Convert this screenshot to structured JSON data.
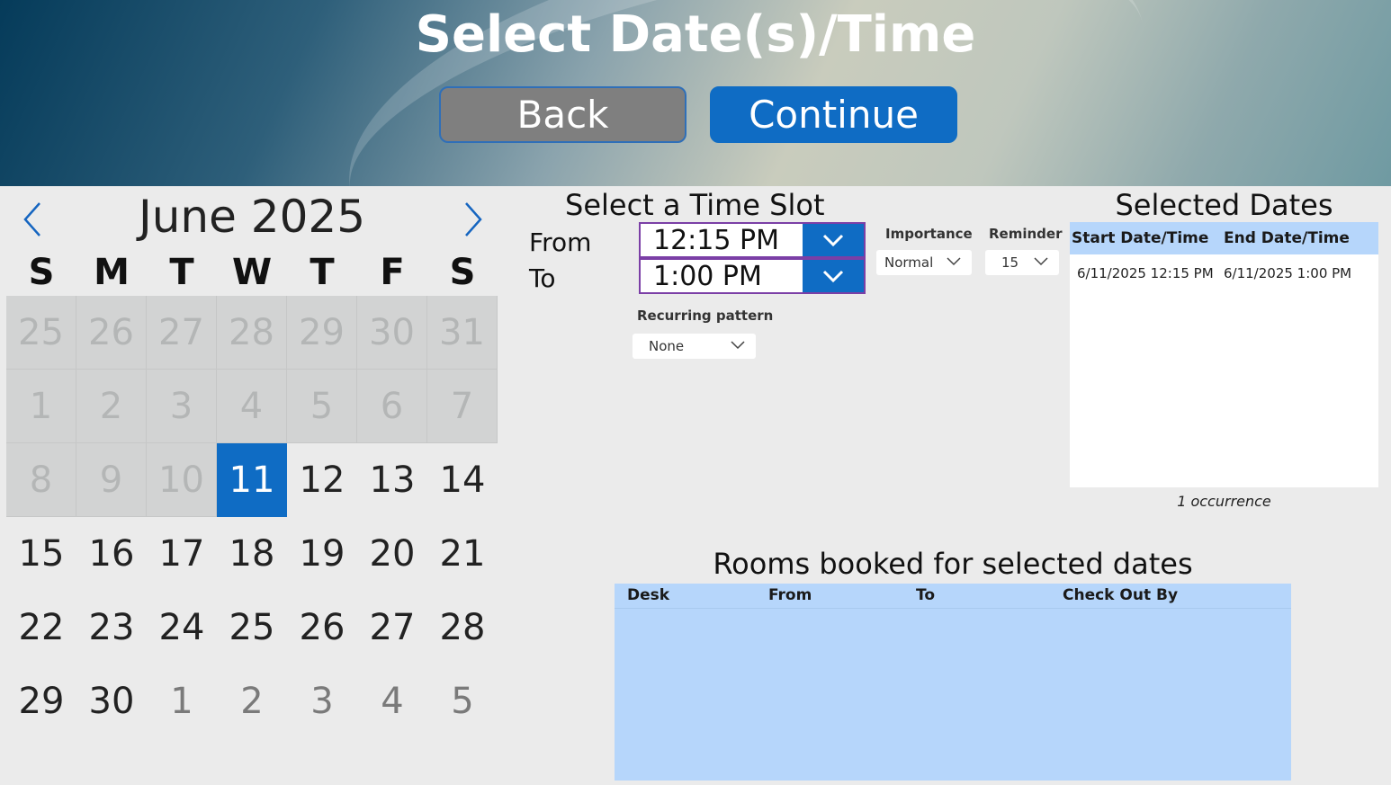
{
  "header": {
    "title": "Select Date(s)/Time",
    "back_label": "Back",
    "continue_label": "Continue"
  },
  "calendar": {
    "month_label": "June 2025",
    "weekdays": [
      "S",
      "M",
      "T",
      "W",
      "T",
      "F",
      "S"
    ],
    "weeks": [
      [
        {
          "d": "25",
          "s": "past"
        },
        {
          "d": "26",
          "s": "past"
        },
        {
          "d": "27",
          "s": "past"
        },
        {
          "d": "28",
          "s": "past"
        },
        {
          "d": "29",
          "s": "past"
        },
        {
          "d": "30",
          "s": "past"
        },
        {
          "d": "31",
          "s": "past"
        }
      ],
      [
        {
          "d": "1",
          "s": "past"
        },
        {
          "d": "2",
          "s": "past"
        },
        {
          "d": "3",
          "s": "past"
        },
        {
          "d": "4",
          "s": "past"
        },
        {
          "d": "5",
          "s": "past"
        },
        {
          "d": "6",
          "s": "past"
        },
        {
          "d": "7",
          "s": "past"
        }
      ],
      [
        {
          "d": "8",
          "s": "past"
        },
        {
          "d": "9",
          "s": "past"
        },
        {
          "d": "10",
          "s": "past"
        },
        {
          "d": "11",
          "s": "selected"
        },
        {
          "d": "12",
          "s": "normal"
        },
        {
          "d": "13",
          "s": "normal"
        },
        {
          "d": "14",
          "s": "normal"
        }
      ],
      [
        {
          "d": "15",
          "s": "normal"
        },
        {
          "d": "16",
          "s": "normal"
        },
        {
          "d": "17",
          "s": "normal"
        },
        {
          "d": "18",
          "s": "normal"
        },
        {
          "d": "19",
          "s": "normal"
        },
        {
          "d": "20",
          "s": "normal"
        },
        {
          "d": "21",
          "s": "normal"
        }
      ],
      [
        {
          "d": "22",
          "s": "normal"
        },
        {
          "d": "23",
          "s": "normal"
        },
        {
          "d": "24",
          "s": "normal"
        },
        {
          "d": "25",
          "s": "normal"
        },
        {
          "d": "26",
          "s": "normal"
        },
        {
          "d": "27",
          "s": "normal"
        },
        {
          "d": "28",
          "s": "normal"
        }
      ],
      [
        {
          "d": "29",
          "s": "normal"
        },
        {
          "d": "30",
          "s": "normal"
        },
        {
          "d": "1",
          "s": "next-month"
        },
        {
          "d": "2",
          "s": "next-month"
        },
        {
          "d": "3",
          "s": "next-month"
        },
        {
          "d": "4",
          "s": "next-month"
        },
        {
          "d": "5",
          "s": "next-month"
        }
      ]
    ],
    "prev_icon": "chevron-left-icon",
    "next_icon": "chevron-right-icon"
  },
  "time_slot": {
    "title": "Select a Time Slot",
    "from_label": "From",
    "to_label": "To",
    "from_value": "12:15 PM",
    "to_value": "1:00 PM",
    "importance_label": "Importance",
    "importance_value": "Normal",
    "reminder_label": "Reminder",
    "reminder_value": "15",
    "recurring_label": "Recurring pattern",
    "recurring_value": "None"
  },
  "selected_dates": {
    "title": "Selected Dates",
    "columns": [
      "Start Date/Time",
      "End Date/Time"
    ],
    "rows": [
      [
        "6/11/2025 12:15 PM",
        "6/11/2025 1:00 PM"
      ]
    ],
    "occurrence_text": "1 occurrence"
  },
  "rooms": {
    "title": "Rooms booked for selected dates",
    "columns": [
      "Desk",
      "From",
      "To",
      "Check Out By"
    ]
  },
  "colors": {
    "accent": "#0f6cc4",
    "table_header": "#b6d6fb",
    "past_day_bg": "#d2d3d3",
    "input_border": "#7b3fa6"
  }
}
